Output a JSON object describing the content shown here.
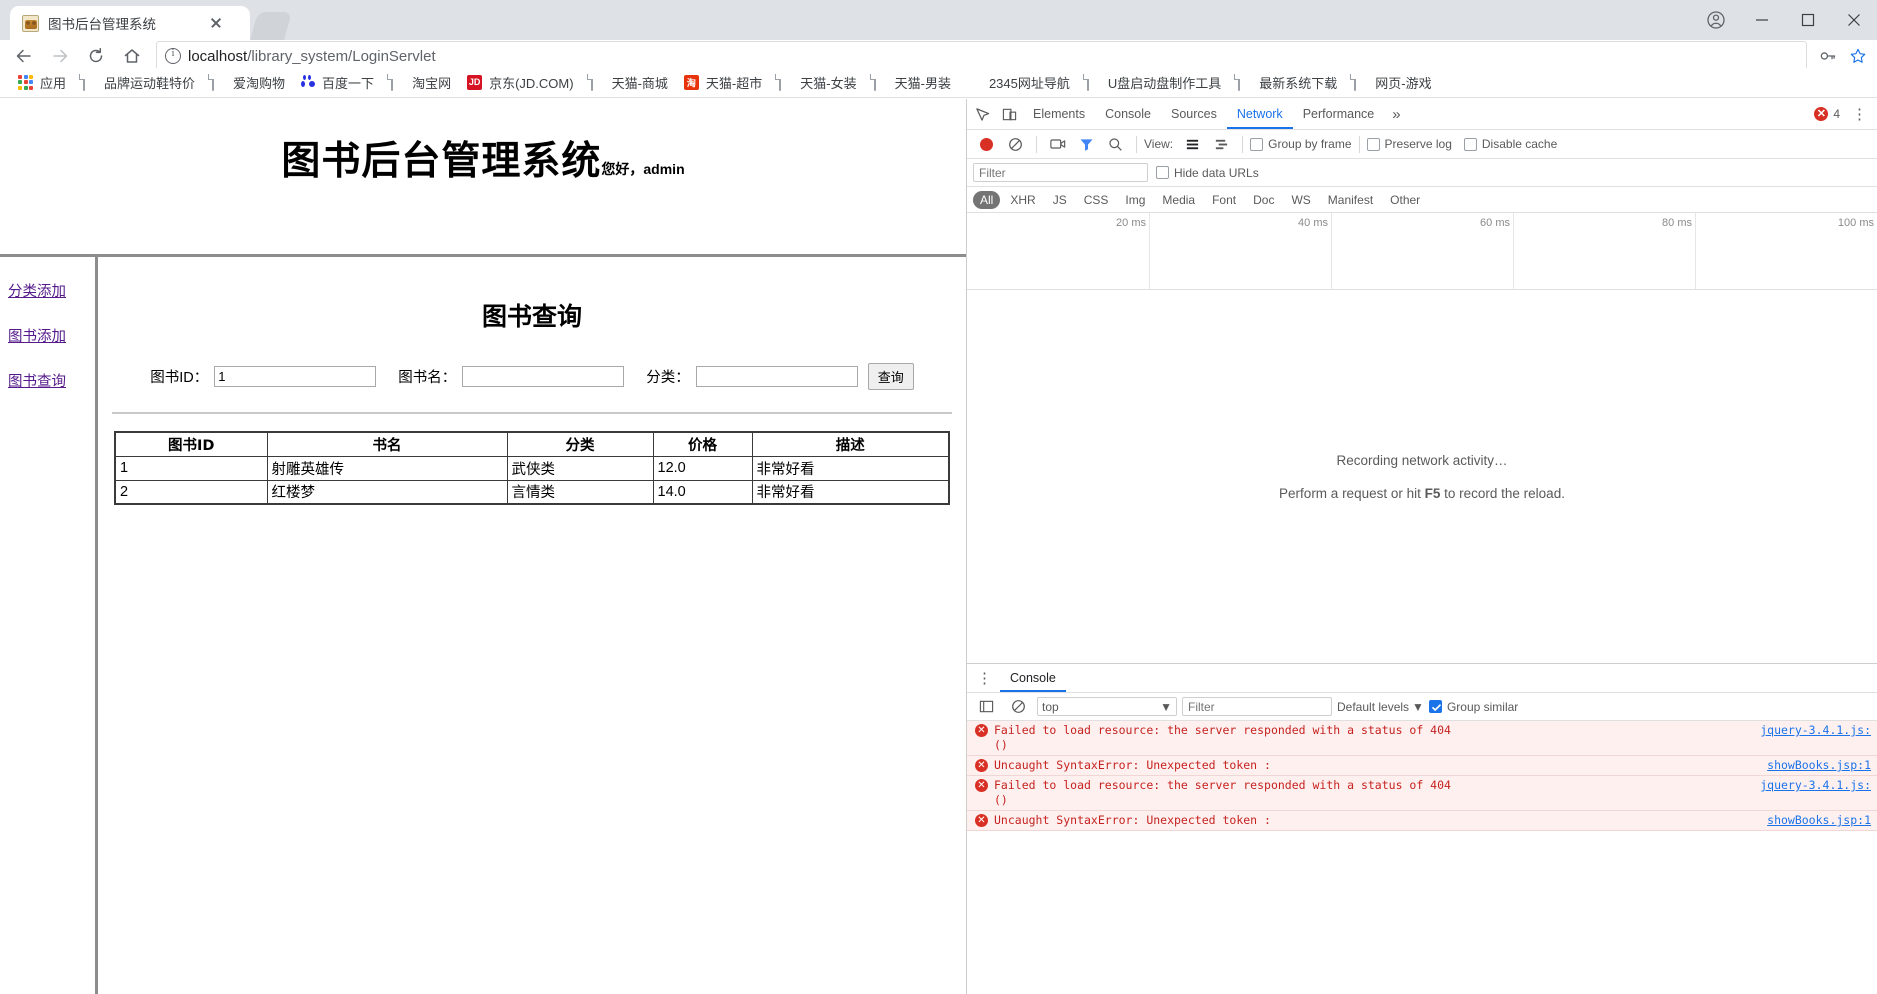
{
  "browser": {
    "tab": {
      "title": "图书后台管理系统",
      "favicon": "lion-favicon",
      "close": "×"
    },
    "nav": {
      "back": "back-arrow",
      "forward": "forward-arrow",
      "reload": "reload-arrow",
      "home": "home-icon"
    },
    "omnibox": {
      "security_icon": "info-circle-icon",
      "url_host": "localhost",
      "url_path": "/library_system/LoginServlet",
      "bookmark_icon": "star-icon",
      "key_icon": "key-icon"
    },
    "window": {
      "profile": "profile-icon",
      "minimize": "–",
      "maximize": "□",
      "close": "×"
    },
    "bookmarks": [
      {
        "label": "应用",
        "icon": "apps-grid-icon"
      },
      {
        "label": "品牌运动鞋特价",
        "icon": "page-icon"
      },
      {
        "label": "爱淘购物",
        "icon": "page-icon"
      },
      {
        "label": "百度一下",
        "icon": "baidu-icon"
      },
      {
        "label": "淘宝网",
        "icon": "page-icon"
      },
      {
        "label": "京东(JD.COM)",
        "icon": "jd-icon",
        "badge": "JD",
        "color": "#d51323"
      },
      {
        "label": "天猫-商城",
        "icon": "page-icon"
      },
      {
        "label": "天猫-超市",
        "icon": "taobao-icon",
        "badge": "淘",
        "color": "#e8340c"
      },
      {
        "label": "天猫-女装",
        "icon": "page-icon"
      },
      {
        "label": "天猫-男装",
        "icon": "page-icon"
      },
      {
        "label": "2345网址导航",
        "icon": "house-icon"
      },
      {
        "label": "U盘启动盘制作工具",
        "icon": "page-icon"
      },
      {
        "label": "最新系统下载",
        "icon": "page-icon"
      },
      {
        "label": "网页-游戏",
        "icon": "page-icon"
      }
    ]
  },
  "page": {
    "header_title": "图书后台管理系统",
    "greeting": "您好，admin",
    "sidebar": [
      {
        "label": "分类添加"
      },
      {
        "label": "图书添加"
      },
      {
        "label": "图书查询"
      }
    ],
    "content_title": "图书查询",
    "form": {
      "id_label": "图书ID：",
      "id_value": "1",
      "name_label": "图书名：",
      "name_value": "",
      "category_label": "分类：",
      "category_value": "",
      "submit_label": "查询"
    },
    "table": {
      "columns": [
        "图书ID",
        "书名",
        "分类",
        "价格",
        "描述"
      ],
      "rows": [
        [
          "1",
          "射雕英雄传",
          "武侠类",
          "12.0",
          "非常好看"
        ],
        [
          "2",
          "红楼梦",
          "言情类",
          "14.0",
          "非常好看"
        ]
      ]
    }
  },
  "devtools": {
    "tabs": [
      "Elements",
      "Console",
      "Sources",
      "Network",
      "Performance"
    ],
    "active_tab": "Network",
    "more_tabs": "»",
    "error_count": "4",
    "kebab": "⋮",
    "inspect_icon": "inspect-icon",
    "device_icon": "device-toolbar-icon",
    "toolbar": {
      "record_icon": "record-button",
      "clear_icon": "clear-icon",
      "filmstrip_icon": "camera-icon",
      "filter_icon": "filter-icon",
      "search_icon": "search-icon",
      "view_label": "View:",
      "view_list_icon": "list-view-icon",
      "view_waterfall_icon": "waterfall-view-icon",
      "group_by_frame": "Group by frame",
      "preserve_log": "Preserve log",
      "disable_cache": "Disable cache"
    },
    "filter": {
      "placeholder": "Filter",
      "value": "",
      "hide_data_urls": "Hide data URLs"
    },
    "types": [
      "All",
      "XHR",
      "JS",
      "CSS",
      "Img",
      "Media",
      "Font",
      "Doc",
      "WS",
      "Manifest",
      "Other"
    ],
    "active_type": "All",
    "timeline_ticks": [
      "20 ms",
      "40 ms",
      "60 ms",
      "80 ms",
      "100 ms"
    ],
    "empty_state": {
      "line1": "Recording network activity…",
      "line2_pre": "Perform a request or hit ",
      "line2_key": "F5",
      "line2_post": " to record the reload."
    },
    "drawer": {
      "kebab": "⋮",
      "tab": "Console",
      "execute_icon": "execute-icon",
      "clear_icon": "clear-console-icon",
      "context": "top",
      "context_caret": "▼",
      "filter_placeholder": "Filter",
      "filter_value": "",
      "levels": "Default levels",
      "levels_caret": "▼",
      "group_similar": "Group similar",
      "messages": [
        {
          "icon": "error-icon",
          "text": "Failed to load resource: the server responded with a status of 404\n()",
          "source": "jquery-3.4.1.js:"
        },
        {
          "icon": "error-icon",
          "text": "Uncaught SyntaxError: Unexpected token :",
          "source": "showBooks.jsp:1"
        },
        {
          "icon": "error-icon",
          "text": "Failed to load resource: the server responded with a status of 404\n()",
          "source": "jquery-3.4.1.js:"
        },
        {
          "icon": "error-icon",
          "text": "Uncaught SyntaxError: Unexpected token :",
          "source": "showBooks.jsp:1"
        }
      ]
    }
  }
}
